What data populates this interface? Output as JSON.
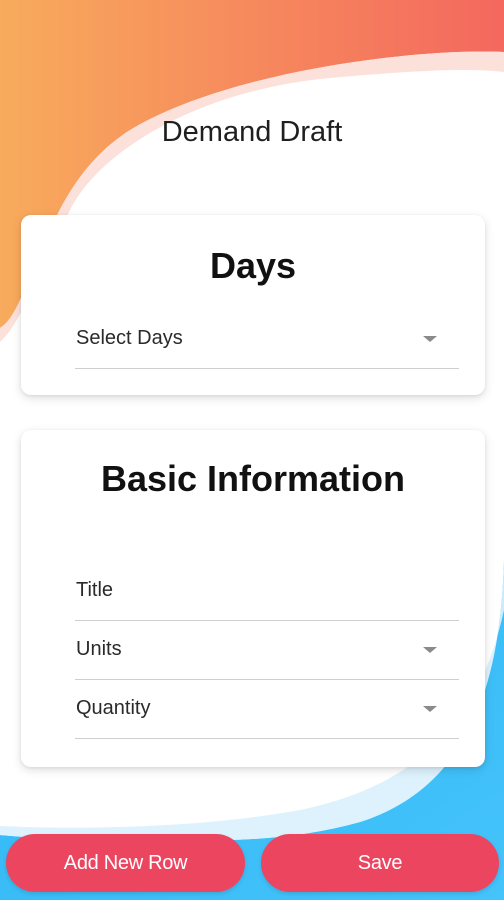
{
  "header": {
    "title": "Demand Draft"
  },
  "days_card": {
    "heading": "Days",
    "select_days": {
      "label": "Select Days",
      "type": "dropdown"
    }
  },
  "basic_info_card": {
    "heading": "Basic Information",
    "fields": [
      {
        "label": "Title",
        "type": "text"
      },
      {
        "label": "Units",
        "type": "dropdown"
      },
      {
        "label": "Quantity",
        "type": "dropdown"
      }
    ]
  },
  "actions": {
    "add_new_row_label": "Add New Row",
    "save_label": "Save"
  },
  "colors": {
    "top_gradient_start": "#f7a65a",
    "top_gradient_end": "#f4685c",
    "bottom_gradient_start": "#2bb0f0",
    "bottom_gradient_end": "#5bd1ff",
    "button": "#ec4560",
    "icons": {
      "dropdown": "chevron-down-icon"
    }
  }
}
